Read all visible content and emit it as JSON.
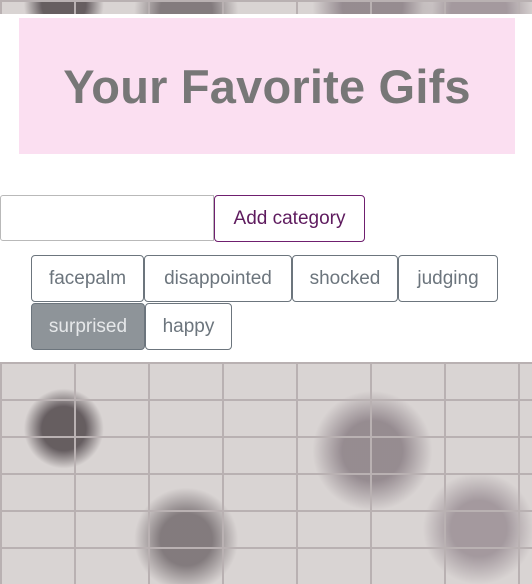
{
  "header": {
    "title": "Your Favorite Gifs"
  },
  "form": {
    "input_value": "",
    "input_placeholder": "",
    "add_label": "Add category"
  },
  "categories": [
    {
      "label": "facepalm",
      "active": false
    },
    {
      "label": "disappointed",
      "active": false
    },
    {
      "label": "shocked",
      "active": false
    },
    {
      "label": "judging",
      "active": false
    },
    {
      "label": "surprised",
      "active": true
    },
    {
      "label": "happy",
      "active": false
    }
  ],
  "colors": {
    "header_background": "#fbdff1",
    "title_text": "#777777",
    "add_button_border": "#6f1f6f",
    "category_border": "#6c757d",
    "active_category_background": "#8e9499"
  }
}
